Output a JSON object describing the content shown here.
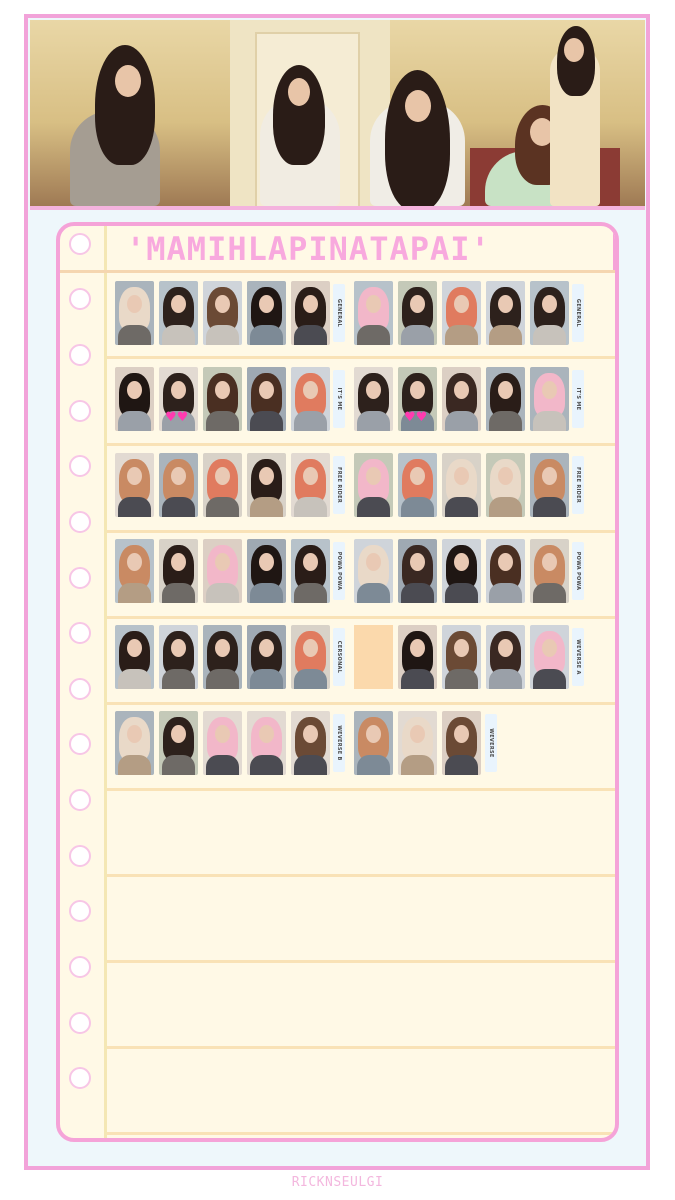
{
  "banner": {
    "name": "group-photo"
  },
  "title": "'MAMIHLAPINATAPAI'",
  "credit": "RICKNSEULGI",
  "colors": {
    "accent_pink": "#f5a3d8",
    "paper": "#fff9e6",
    "line": "#f9e2b6",
    "background": "#eef7fb"
  },
  "rows": [
    {
      "left_label": "GENERAL",
      "right_label": "GENERAL"
    },
    {
      "left_label": "IT'S ME",
      "right_label": "IT'S ME"
    },
    {
      "left_label": "FREE RIDER",
      "right_label": "FREE RIDER"
    },
    {
      "left_label": "POWA POWA",
      "right_label": "POWA POWA"
    },
    {
      "left_label": "CERSONAL",
      "right_label": "WEVERSE A"
    },
    {
      "left_label": "WEVERSE B",
      "right_label": "WEVERSE"
    }
  ]
}
